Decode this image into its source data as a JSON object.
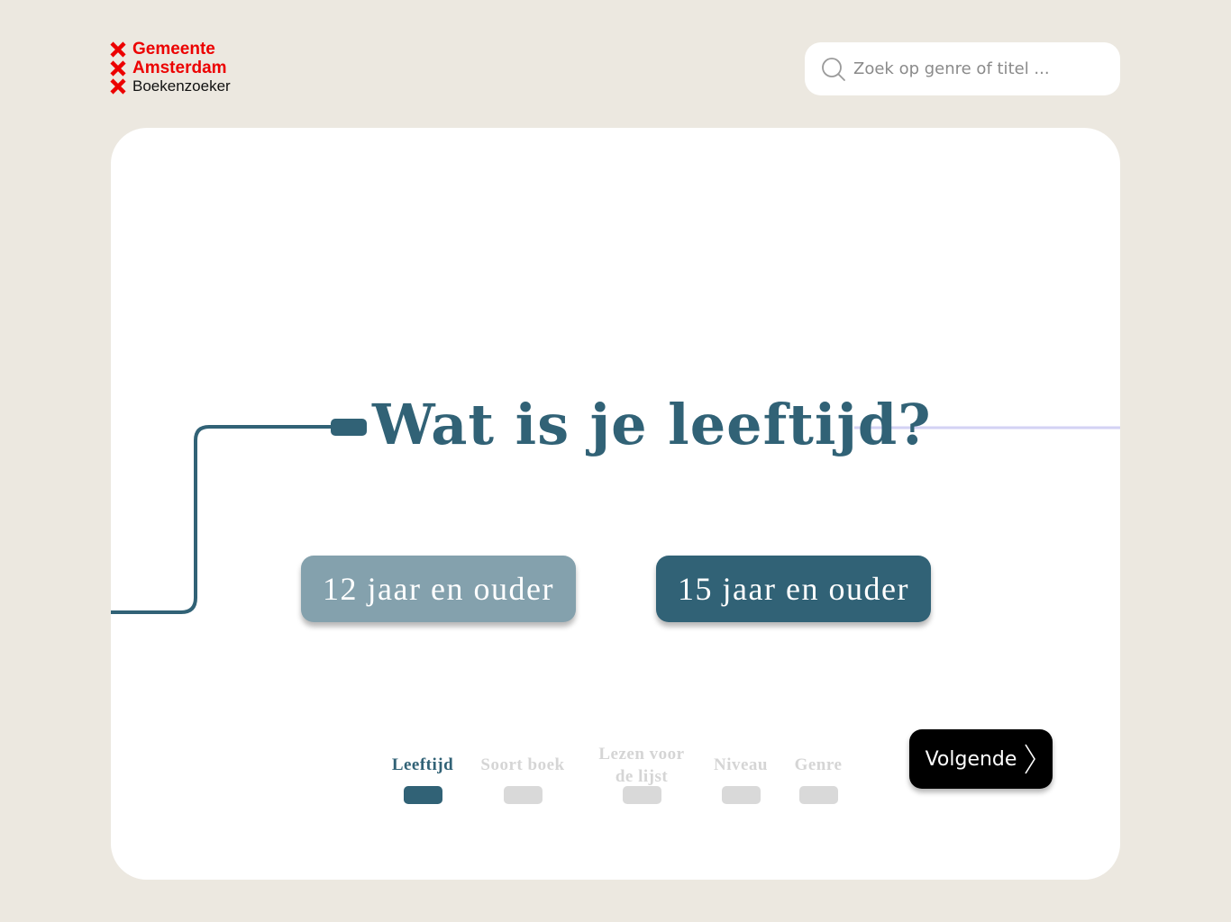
{
  "logo": {
    "line1": "Gemeente",
    "line2": "Amsterdam",
    "line3": "Boekenzoeker",
    "brand_color": "#ec0000",
    "icon": "amsterdam-x-icon"
  },
  "search": {
    "placeholder": "Zoek op genre of titel ...",
    "icon": "search-icon"
  },
  "question": {
    "title": "Wat is je leeftijd?"
  },
  "options": [
    {
      "label": "12 jaar en ouder",
      "selected": false
    },
    {
      "label": "15 jaar en ouder",
      "selected": true
    }
  ],
  "progress": {
    "steps": [
      {
        "label": "Leeftijd",
        "active": true
      },
      {
        "label": "Soort boek",
        "active": false
      },
      {
        "label": "Lezen voor de lijst",
        "active": false
      },
      {
        "label": "Niveau",
        "active": false
      },
      {
        "label": "Genre",
        "active": false
      }
    ]
  },
  "next_button": {
    "label": "Volgende",
    "icon": "chevron-right-icon"
  },
  "colors": {
    "background": "#ece8e0",
    "primary": "#316276",
    "option_muted": "#84a1ad",
    "accent_line": "#d3d2f4",
    "inactive": "#d9d9d9"
  }
}
